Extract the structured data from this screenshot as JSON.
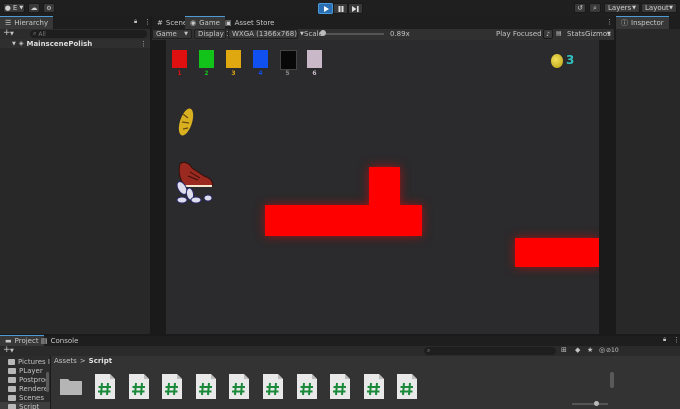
{
  "toolbar": {
    "account_label": "E",
    "play_icon": "play-icon",
    "pause_icon": "pause-icon",
    "step_icon": "step-icon",
    "layers_label": "Layers",
    "layout_label": "Layout"
  },
  "hierarchy": {
    "tab_label": "Hierarchy",
    "add_label": "+",
    "search_placeholder": "All",
    "scene_name": "MainscenePolish"
  },
  "center_tabs": {
    "scene": "Scene",
    "game": "Game",
    "asset_store": "Asset Store"
  },
  "game_toolbar": {
    "mode": "Game",
    "display": "Display 1",
    "resolution": "WXGA (1366x768)",
    "scale_label": "Scale",
    "scale_value": "0.89x",
    "play_focused": "Play Focused",
    "stats": "Stats",
    "gizmos": "Gizmos"
  },
  "inspector": {
    "tab_label": "Inspector"
  },
  "game_view": {
    "swatches": [
      {
        "num": "1",
        "color": "#e01010"
      },
      {
        "num": "2",
        "color": "#12c41a"
      },
      {
        "num": "3",
        "color": "#e0a810"
      },
      {
        "num": "4",
        "color": "#1050f0"
      },
      {
        "num": "5",
        "color": "#080808"
      },
      {
        "num": "6",
        "color": "#c8b8c8"
      }
    ],
    "coin_count": "3",
    "block_color": "#ff0000"
  },
  "bottom_tabs": {
    "project": "Project",
    "console": "Console"
  },
  "project": {
    "add_label": "+",
    "folders": [
      "Pictures I",
      "PLayer",
      "Postproc",
      "Rendere",
      "Scenes",
      "Script"
    ],
    "breadcrumb_root": "Assets",
    "breadcrumb_current": "Script",
    "count_label": "10",
    "script_count": 10
  }
}
